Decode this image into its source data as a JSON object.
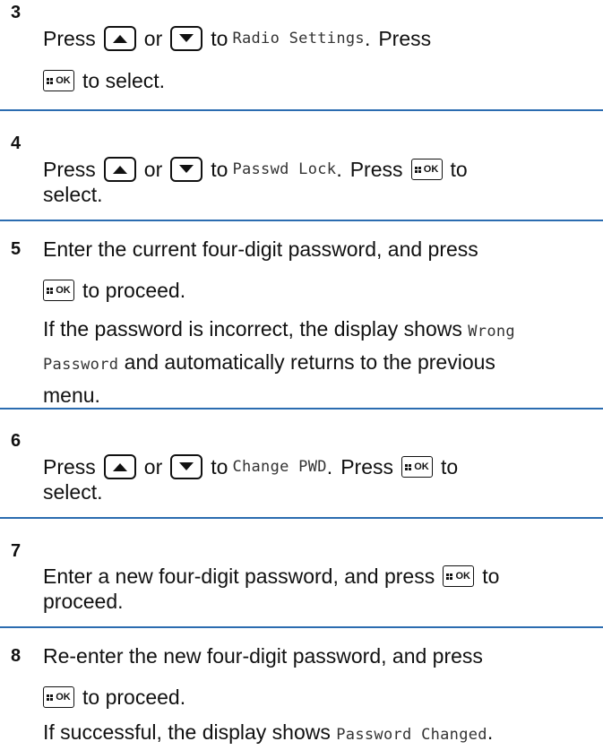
{
  "steps": [
    {
      "num": "3",
      "lines": [
        {
          "press": "Press",
          "or": "or",
          "to": "to",
          "target": "Radio Settings",
          "press2": "Press"
        },
        {
          "tail": "to select."
        }
      ]
    },
    {
      "num": "4",
      "line": {
        "press": "Press",
        "or": "or",
        "to": "to",
        "target": "Passwd Lock",
        "press2": "Press",
        "tail": "to"
      },
      "line2": "select."
    },
    {
      "num": "5",
      "text": "Enter the current four-digit password, and press",
      "tail": "to proceed.",
      "note": {
        "a": "If the password is incorrect, the display shows",
        "mono1": "Wrong",
        "mono2": "Password",
        "b": "and automatically returns to the previous",
        "c": "menu."
      }
    },
    {
      "num": "6",
      "line": {
        "press": "Press",
        "or": "or",
        "to": "to",
        "target": "Change PWD",
        "press2": "Press",
        "tail": "to"
      },
      "line2": "select."
    },
    {
      "num": "7",
      "text": "Enter a new four-digit password, and press",
      "tail": "to",
      "line2": "proceed."
    },
    {
      "num": "8",
      "text": "Re-enter the new four-digit password, and press",
      "tail": "to proceed.",
      "note": {
        "a": "If successful, the display shows",
        "mono": "Password Changed",
        "end": "."
      }
    }
  ],
  "icons": {
    "up": "up-arrow-key-icon",
    "down": "down-arrow-key-icon",
    "ok": "menu-ok-key-icon"
  },
  "ok_label": "OK",
  "colors": {
    "rule": "#2b6cb0"
  }
}
